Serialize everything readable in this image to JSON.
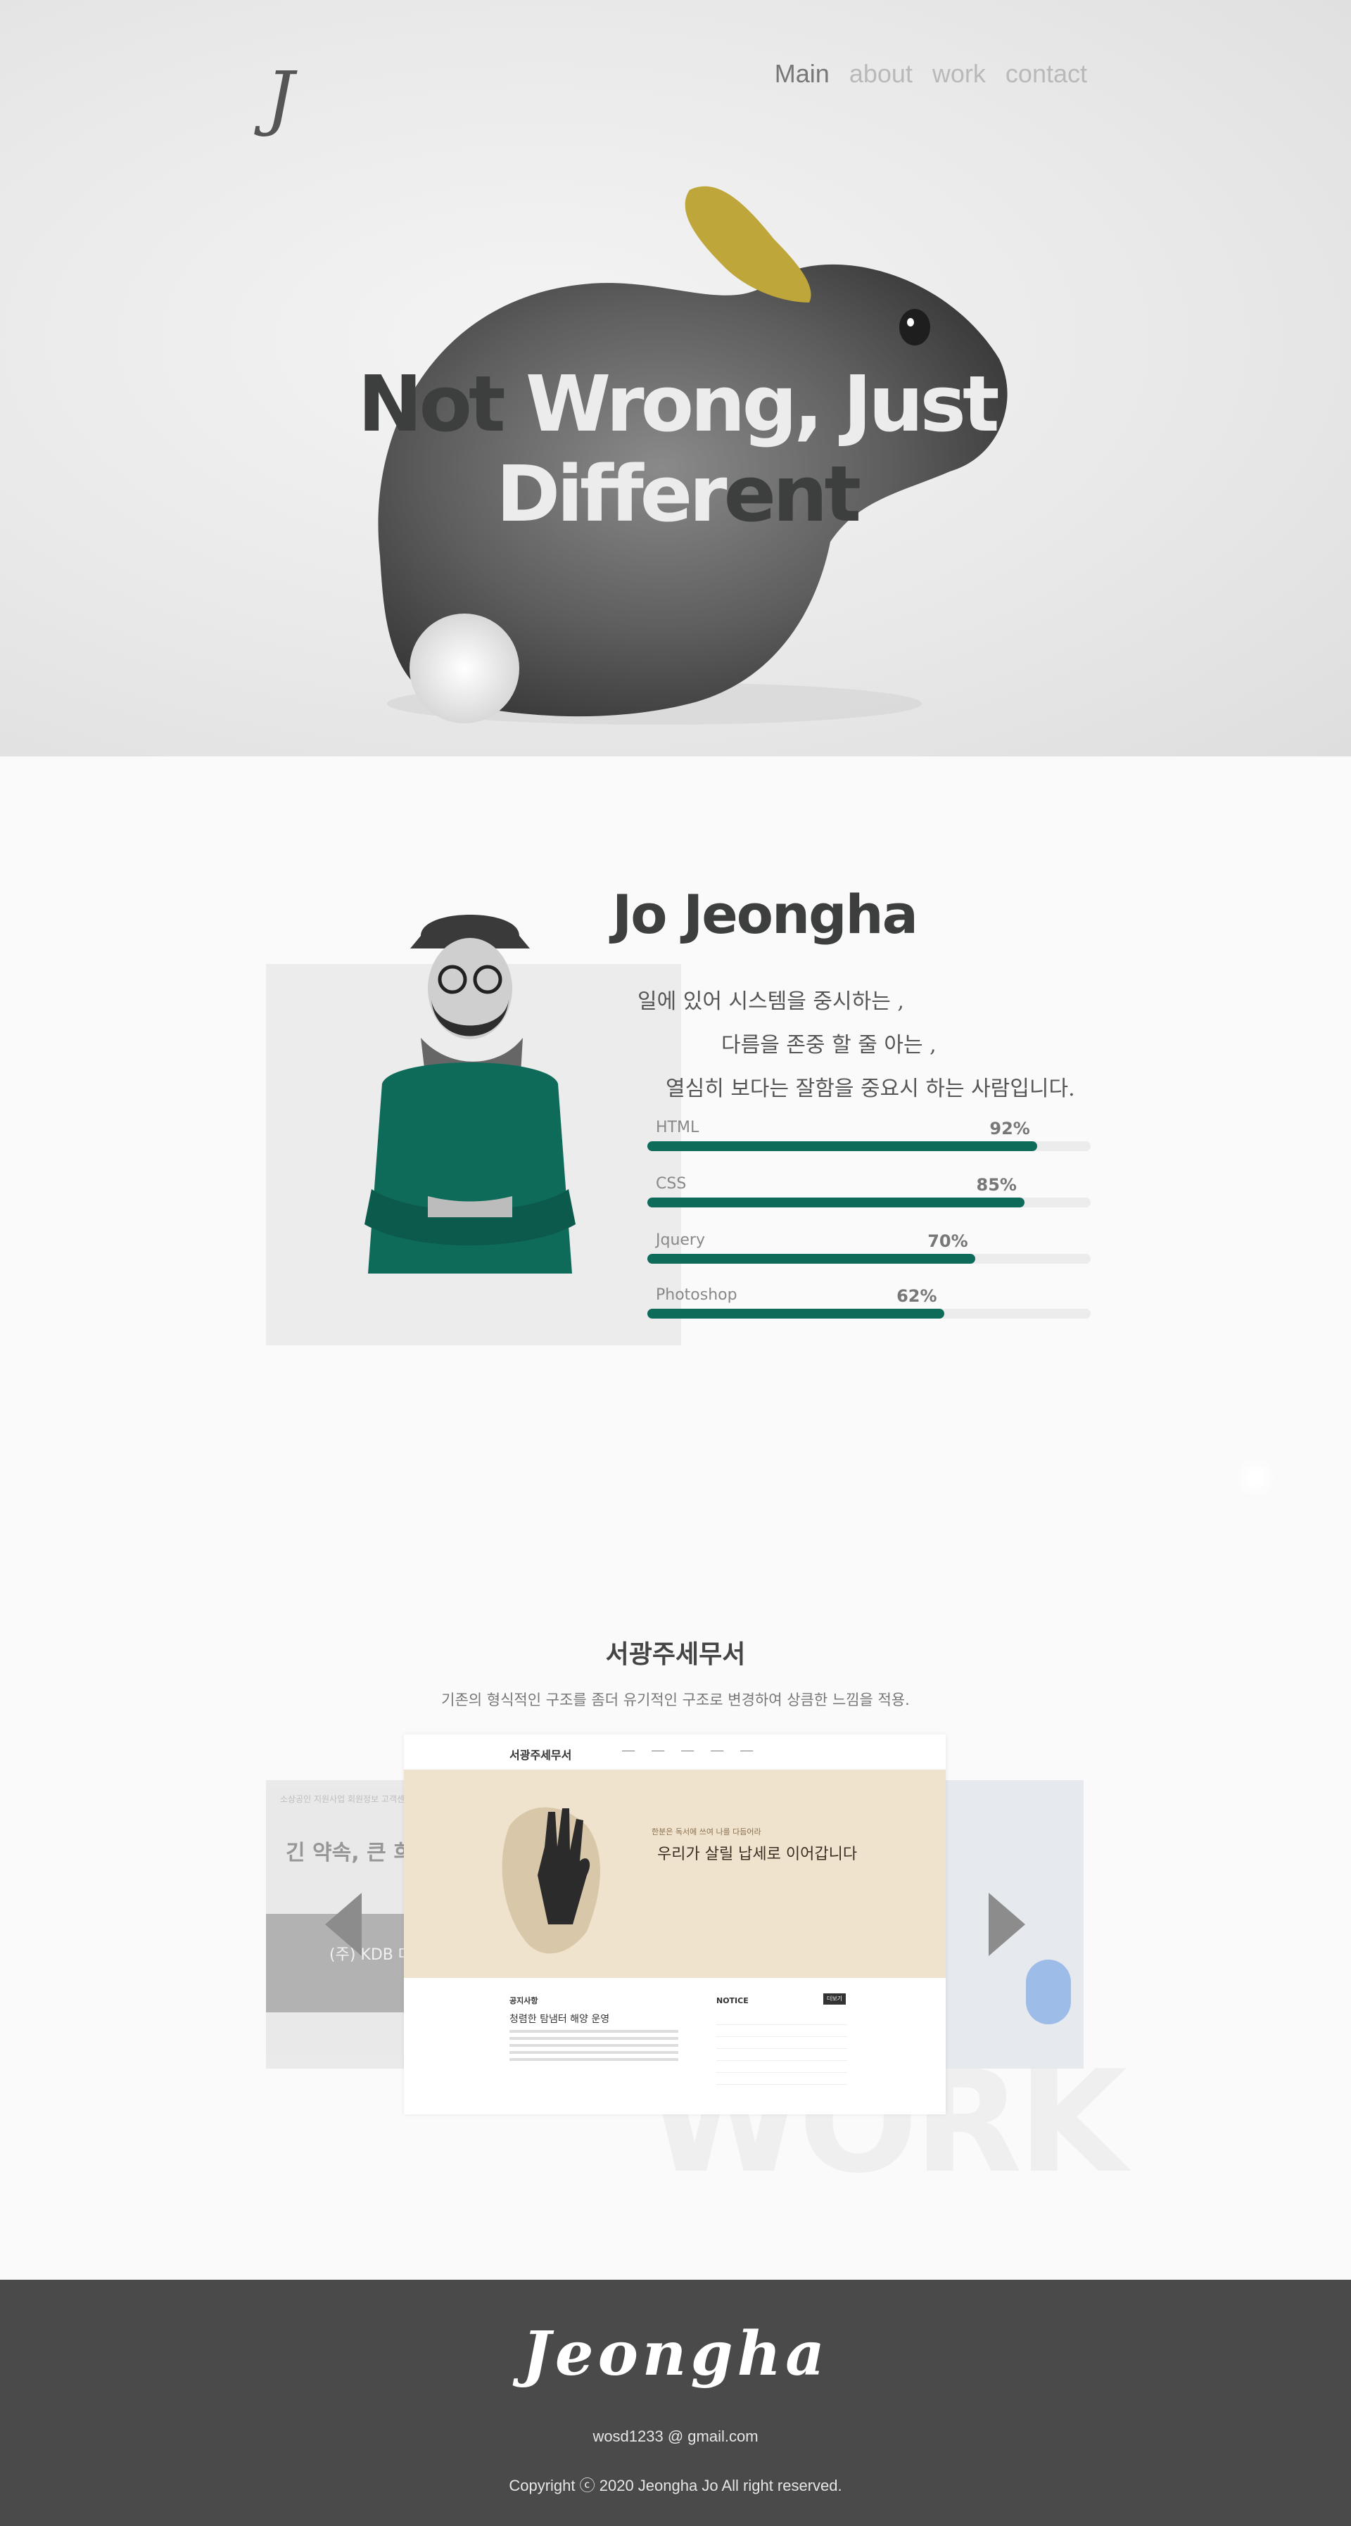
{
  "header": {
    "logo": "J",
    "nav": [
      {
        "label": "Main",
        "active": true
      },
      {
        "label": "about",
        "active": false
      },
      {
        "label": "work",
        "active": false
      },
      {
        "label": "contact",
        "active": false
      }
    ]
  },
  "hero": {
    "title_part1": "Not ",
    "title_part2": "Wrong, Just Differ",
    "title_part3": "ent"
  },
  "about": {
    "name": "Jo Jeongha",
    "intro_lines": [
      "일에 있어 시스템을 중시하는 ,",
      "다름을 존중 할 줄 아는 ,",
      "열심히 보다는 잘함을 중요시 하는 사람입니다."
    ],
    "skills": [
      {
        "label": "HTML",
        "percent_text": "92%",
        "value": 0.88
      },
      {
        "label": "CSS",
        "percent_text": "85%",
        "value": 0.85
      },
      {
        "label": "Jquery",
        "percent_text": "70%",
        "value": 0.74
      },
      {
        "label": "Photoshop",
        "percent_text": "62%",
        "value": 0.67
      }
    ],
    "accent_color": "#0e6b5a"
  },
  "work": {
    "title": "서광주세무서",
    "description": "기존의 형식적인 구조를 좀더 유기적인 구조로 변경하여 상큼한 느낌을 적용.",
    "watermark": "WORK",
    "main_site": {
      "logo": "서광주세무서",
      "banner_small": "한분은 독서에 쓰여 나를 다듬어라",
      "banner_main": "우리가 살릴 납세로 이어갑니다",
      "news_heading": "공지사항",
      "news_title": "청렴한 탐냄터 해양 운영",
      "notice_heading": "NOTICE",
      "notice_button": "더보기"
    },
    "left_site": {
      "nav": "소상공인 지원사업  회원정보  고객센터",
      "title": "긴 약속, 큰 희망",
      "band_text": "(주) KDB 대한 건강"
    }
  },
  "footer": {
    "name": "Jeongha",
    "email": "wosd1233 @ gmail.com",
    "copyright": "Copyright ⓒ 2020 Jeongha Jo All right reserved."
  }
}
